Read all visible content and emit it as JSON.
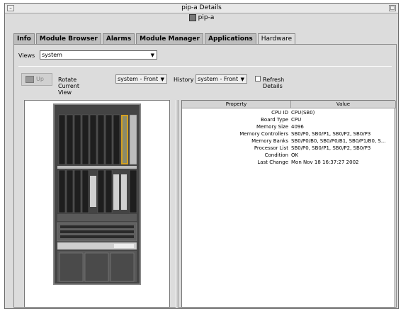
{
  "window": {
    "title": "pip-a Details",
    "minimize_glyph": "–",
    "maximize_glyph": "□",
    "subtitle": "pip-a"
  },
  "tabs": [
    {
      "label": "Info"
    },
    {
      "label": "Module Browser"
    },
    {
      "label": "Alarms"
    },
    {
      "label": "Module Manager"
    },
    {
      "label": "Applications"
    },
    {
      "label": "Hardware"
    }
  ],
  "views": {
    "label": "Views",
    "value": "system"
  },
  "toolbar": {
    "up_label": "Up",
    "rotate_label": "Rotate Current View",
    "rotate_value": "system - Front",
    "history_label": "History",
    "history_value": "system - Front",
    "refresh_label": "Refresh Details"
  },
  "table": {
    "col_property": "Property",
    "col_value": "Value",
    "rows": [
      {
        "property": "CPU ID",
        "value": "CPU(SB0)"
      },
      {
        "property": "Board Type",
        "value": "CPU"
      },
      {
        "property": "Memory Size",
        "value": "4096"
      },
      {
        "property": "Memory Controllers",
        "value": "SB0/P0, SB0/P1, SB0/P2, SB0/P3"
      },
      {
        "property": "Memory Banks",
        "value": "SB0/P0/B0, SB0/P0/B1, SB0/P1/B0, S..."
      },
      {
        "property": "Processor List",
        "value": "SB0/P0, SB0/P1, SB0/P2, SB0/P3"
      },
      {
        "property": "Condition",
        "value": "OK"
      },
      {
        "property": "Last Change",
        "value": "Mon Nov 18 16:37:27 2002"
      }
    ]
  },
  "colors": {
    "window_bg": "#dcdcdc",
    "rack_dark": "#3a3a3a",
    "rack_highlight": "#d4a020"
  },
  "icons": {
    "dropdown": "chevron-down-icon",
    "up": "up-folder-icon",
    "window": "server-icon"
  }
}
